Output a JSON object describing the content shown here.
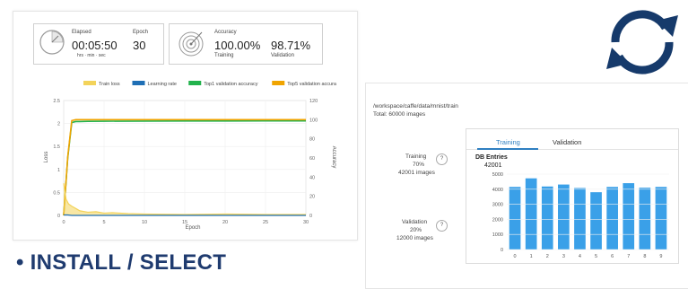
{
  "dashboard": {
    "elapsed_label": "Elapsed",
    "elapsed_value": "00:05:50",
    "time_units": "hrs · min · sec",
    "epoch_label": "Epoch",
    "epoch_value": "30",
    "accuracy_label": "Accuracy",
    "training_value": "100.00%",
    "training_label": "Training",
    "validation_value": "98.71%",
    "validation_label": "Validation"
  },
  "bullet": "• INSTALL / SELECT",
  "dataset": {
    "path": "/workspace/caffe/data/mnist/train",
    "total": "Total: 60000 images",
    "training_label": "Training",
    "training_pct": "70%",
    "training_images": "42001 images",
    "validation_label": "Validation",
    "validation_pct": "20%",
    "validation_images": "12000 images",
    "help": "?",
    "tab_training": "Training",
    "tab_validation": "Validation"
  },
  "colors": {
    "train_loss": "#f3d35a",
    "learning_rate": "#1f6fb5",
    "top1": "#22b24c",
    "top5": "#f0a400",
    "bars": "#3aa0e8",
    "bullet_text": "#1f3b6f",
    "sync_icon": "#163a6b"
  },
  "icons": [
    "timer-icon",
    "target-icon",
    "sync-arrows-icon",
    "help-icon"
  ],
  "chart_data": [
    {
      "type": "line",
      "legend": [
        "Train loss",
        "Learning rate",
        "Top1 validation accuracy",
        "Top5 validation accuracy"
      ],
      "legend_position": "top",
      "xlabel": "Epoch",
      "ylabel": "Loss",
      "y2label": "Accuracy",
      "xlim": [
        0,
        30
      ],
      "ylim": [
        0,
        2.5
      ],
      "y2lim": [
        0,
        120
      ],
      "x_ticks": [
        "0",
        "5",
        "10",
        "15",
        "20",
        "25",
        "30"
      ],
      "y_ticks": [
        "0",
        "0.5",
        "1",
        "1.5",
        "2",
        "2.5"
      ],
      "y2_ticks": [
        "0",
        "20",
        "40",
        "60",
        "80",
        "100",
        "120"
      ],
      "grid": true,
      "series": [
        {
          "name": "Top1 validation accuracy",
          "axis": "right",
          "x": [
            0,
            0.5,
            1,
            1.5,
            2,
            3,
            5,
            10,
            15,
            20,
            25,
            30
          ],
          "y": [
            0,
            60,
            97,
            98,
            98,
            98.3,
            98.4,
            98.5,
            98.6,
            98.6,
            98.7,
            98.71
          ]
        },
        {
          "name": "Top5 validation accuracy",
          "axis": "right",
          "x": [
            0,
            0.5,
            1,
            1.5,
            2,
            3,
            5,
            10,
            15,
            20,
            25,
            30
          ],
          "y": [
            0,
            61,
            99,
            100,
            100,
            100,
            100,
            100,
            100,
            100,
            100,
            100
          ]
        },
        {
          "name": "Train loss",
          "axis": "left",
          "x": [
            0,
            0.3,
            0.6,
            1,
            1.5,
            2,
            3,
            4,
            5,
            6,
            8,
            10,
            15,
            20,
            25,
            30
          ],
          "y": [
            0.7,
            0.35,
            0.25,
            0.2,
            0.15,
            0.1,
            0.07,
            0.08,
            0.05,
            0.06,
            0.04,
            0.03,
            0.02,
            0.03,
            0.02,
            0.02
          ]
        },
        {
          "name": "Learning rate",
          "axis": "left",
          "x": [
            0,
            0.5,
            1,
            1.5,
            30
          ],
          "y": [
            0.01,
            0.01,
            0,
            0,
            0
          ]
        }
      ]
    },
    {
      "type": "bar",
      "title": "DB Entries",
      "max_label": "42001",
      "categories": [
        "0",
        "1",
        "2",
        "3",
        "4",
        "5",
        "6",
        "7",
        "8",
        "9"
      ],
      "values": [
        4150,
        4720,
        4180,
        4310,
        4080,
        3800,
        4150,
        4400,
        4100,
        4150
      ],
      "y_ticks": [
        "0",
        "1000",
        "2000",
        "3000",
        "4000",
        "5000"
      ],
      "ylim": [
        0,
        5000
      ]
    }
  ]
}
